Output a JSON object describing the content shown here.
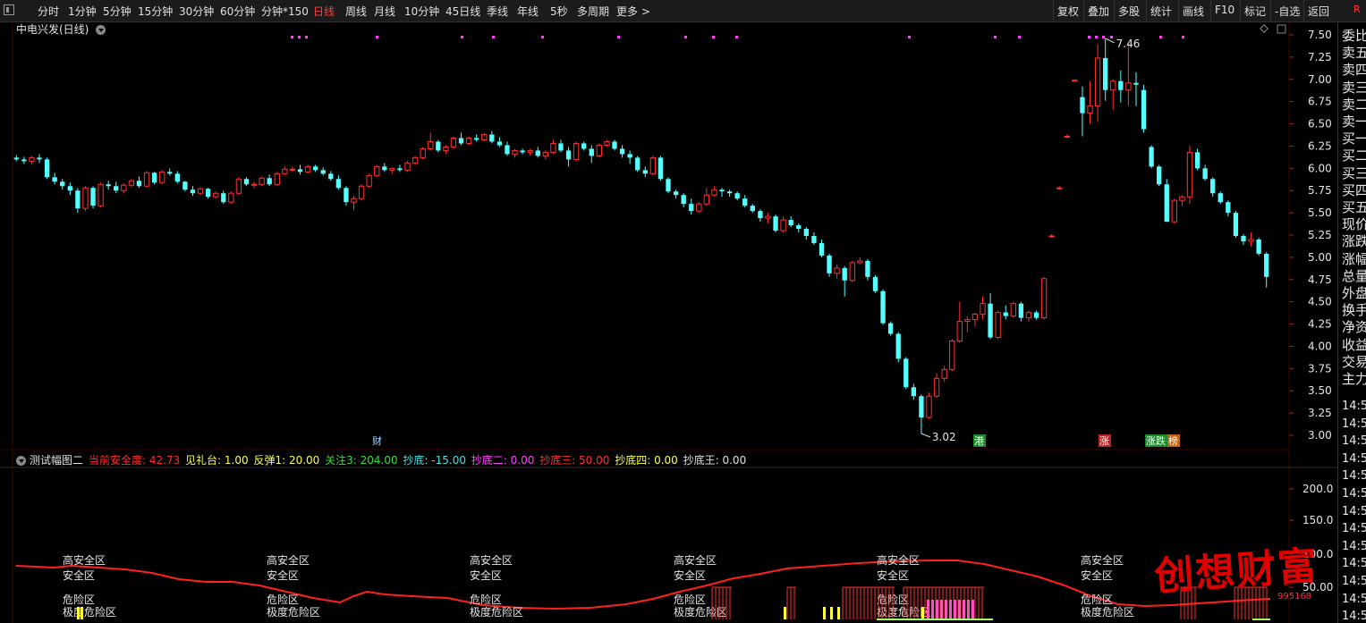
{
  "toolbar": {
    "items": [
      "分时",
      "1分钟",
      "5分钟",
      "15分钟",
      "30分钟",
      "60分钟",
      "分钟*150",
      "日线",
      "周线",
      "月线",
      "10分钟",
      "45日线",
      "季线",
      "年线",
      "5秒",
      "多周期",
      "更多 >"
    ],
    "active_index": 7,
    "right_items": [
      "复权",
      "叠加",
      "多股",
      "统计",
      "画线",
      "F10",
      "标记",
      "-自选",
      "返回"
    ],
    "corner": "R"
  },
  "title": {
    "stock_name": "中电兴发(日线)"
  },
  "right_panel": {
    "labels": [
      "委比",
      "卖五",
      "卖四",
      "卖三",
      "卖二",
      "卖一",
      "买一",
      "买二",
      "买三",
      "买四",
      "买五",
      "现价",
      "涨跌",
      "涨幅",
      "总量",
      "外盘",
      "换手",
      "净资",
      "收益",
      "交易",
      "主力"
    ],
    "times": [
      "14:5",
      "14:5",
      "14:5",
      "14:5",
      "14:5",
      "14:5",
      "14:5",
      "14:5",
      "14:5",
      "14:5",
      "14:5",
      "14:5",
      "14:5"
    ]
  },
  "indicator": {
    "name": "测试幅图二",
    "items": [
      {
        "label": "当前安全度:",
        "value": "42.73",
        "color": "#ff2a2a"
      },
      {
        "label": "见礼台:",
        "value": "1.00",
        "color": "#ffff50"
      },
      {
        "label": "反弹1:",
        "value": "20.00",
        "color": "#ffff50"
      },
      {
        "label": "关注3:",
        "value": "204.00",
        "color": "#30e030"
      },
      {
        "label": "抄底:",
        "value": "-15.00",
        "color": "#40e0e0"
      },
      {
        "label": "抄底二:",
        "value": "0.00",
        "color": "#ff40ff"
      },
      {
        "label": "抄底三:",
        "value": "50.00",
        "color": "#ff3030"
      },
      {
        "label": "抄底四:",
        "value": "0.00",
        "color": "#ffff50"
      },
      {
        "label": "抄底王:",
        "value": "0.00",
        "color": "#e0e0e0"
      }
    ],
    "zones": [
      "高安全区",
      "安全区",
      "危险区",
      "极度危险区"
    ],
    "y_ticks": [
      "200.0",
      "150.0",
      "100.0",
      "50.00"
    ]
  },
  "logo": {
    "text": "创想财富",
    "sub": "995168"
  },
  "chart_data": {
    "type": "candlestick",
    "ylim": [
      2.85,
      7.6
    ],
    "y_ticks": [
      "7.50",
      "7.25",
      "7.00",
      "6.75",
      "6.50",
      "6.25",
      "6.00",
      "5.75",
      "5.50",
      "5.25",
      "5.00",
      "4.75",
      "4.50",
      "4.25",
      "4.00",
      "3.75",
      "3.50",
      "3.25",
      "3.00"
    ],
    "high_label": "7.46",
    "low_label": "3.02",
    "markers": [
      "财",
      "港",
      "涨",
      "涨跌",
      "榜"
    ],
    "colors": {
      "up": "#ff3030",
      "down": "#54ffff",
      "signal_dot": "#ff40ff",
      "safety_line": "#ff2020"
    },
    "ohlc": [
      [
        6.12,
        6.15,
        6.08,
        6.1
      ],
      [
        6.1,
        6.13,
        6.05,
        6.08
      ],
      [
        6.08,
        6.14,
        6.04,
        6.12
      ],
      [
        6.12,
        6.16,
        6.06,
        6.1
      ],
      [
        6.1,
        6.12,
        5.88,
        5.9
      ],
      [
        5.9,
        5.95,
        5.82,
        5.85
      ],
      [
        5.85,
        5.88,
        5.76,
        5.8
      ],
      [
        5.8,
        5.84,
        5.7,
        5.75
      ],
      [
        5.75,
        5.78,
        5.5,
        5.55
      ],
      [
        5.55,
        5.8,
        5.52,
        5.78
      ],
      [
        5.78,
        5.8,
        5.55,
        5.58
      ],
      [
        5.58,
        5.84,
        5.56,
        5.82
      ],
      [
        5.82,
        5.86,
        5.76,
        5.8
      ],
      [
        5.8,
        5.85,
        5.72,
        5.75
      ],
      [
        5.75,
        5.83,
        5.72,
        5.81
      ],
      [
        5.81,
        5.88,
        5.79,
        5.86
      ],
      [
        5.86,
        5.91,
        5.78,
        5.8
      ],
      [
        5.8,
        5.97,
        5.79,
        5.95
      ],
      [
        5.95,
        5.96,
        5.82,
        5.84
      ],
      [
        5.84,
        5.98,
        5.82,
        5.96
      ],
      [
        5.96,
        6.0,
        5.92,
        5.94
      ],
      [
        5.94,
        5.97,
        5.83,
        5.85
      ],
      [
        5.85,
        5.86,
        5.74,
        5.76
      ],
      [
        5.76,
        5.8,
        5.69,
        5.72
      ],
      [
        5.72,
        5.79,
        5.7,
        5.77
      ],
      [
        5.77,
        5.78,
        5.66,
        5.68
      ],
      [
        5.68,
        5.74,
        5.66,
        5.72
      ],
      [
        5.72,
        5.75,
        5.6,
        5.62
      ],
      [
        5.62,
        5.74,
        5.6,
        5.72
      ],
      [
        5.72,
        5.9,
        5.7,
        5.88
      ],
      [
        5.88,
        5.9,
        5.8,
        5.82
      ],
      [
        5.82,
        5.85,
        5.78,
        5.82
      ],
      [
        5.82,
        5.91,
        5.8,
        5.89
      ],
      [
        5.89,
        5.93,
        5.8,
        5.82
      ],
      [
        5.82,
        5.96,
        5.8,
        5.94
      ],
      [
        5.94,
        6.02,
        5.92,
        5.99
      ],
      [
        5.99,
        6.02,
        5.96,
        5.99
      ],
      [
        5.99,
        6.04,
        5.93,
        5.96
      ],
      [
        5.96,
        6.04,
        5.94,
        6.02
      ],
      [
        6.02,
        6.04,
        5.96,
        5.98
      ],
      [
        5.98,
        6.01,
        5.92,
        5.94
      ],
      [
        5.94,
        5.97,
        5.86,
        5.88
      ],
      [
        5.88,
        5.92,
        5.76,
        5.78
      ],
      [
        5.78,
        5.8,
        5.58,
        5.62
      ],
      [
        5.62,
        5.69,
        5.53,
        5.66
      ],
      [
        5.66,
        5.82,
        5.64,
        5.8
      ],
      [
        5.8,
        5.94,
        5.78,
        5.92
      ],
      [
        5.92,
        6.04,
        5.9,
        6.02
      ],
      [
        6.02,
        6.06,
        5.96,
        5.98
      ],
      [
        5.98,
        6.01,
        5.94,
        6.0
      ],
      [
        6.0,
        6.04,
        5.96,
        5.98
      ],
      [
        5.98,
        6.08,
        5.96,
        6.06
      ],
      [
        6.06,
        6.14,
        6.04,
        6.12
      ],
      [
        6.12,
        6.24,
        6.1,
        6.22
      ],
      [
        6.22,
        6.4,
        6.2,
        6.3
      ],
      [
        6.3,
        6.32,
        6.18,
        6.2
      ],
      [
        6.2,
        6.26,
        6.16,
        6.24
      ],
      [
        6.24,
        6.36,
        6.22,
        6.34
      ],
      [
        6.34,
        6.4,
        6.26,
        6.28
      ],
      [
        6.28,
        6.36,
        6.26,
        6.34
      ],
      [
        6.34,
        6.38,
        6.3,
        6.32
      ],
      [
        6.32,
        6.4,
        6.3,
        6.38
      ],
      [
        6.38,
        6.42,
        6.28,
        6.3
      ],
      [
        6.3,
        6.35,
        6.24,
        6.26
      ],
      [
        6.26,
        6.3,
        6.14,
        6.16
      ],
      [
        6.16,
        6.22,
        6.12,
        6.2
      ],
      [
        6.2,
        6.22,
        6.16,
        6.18
      ],
      [
        6.18,
        6.22,
        6.14,
        6.2
      ],
      [
        6.2,
        6.24,
        6.12,
        6.14
      ],
      [
        6.14,
        6.2,
        6.1,
        6.18
      ],
      [
        6.18,
        6.32,
        6.16,
        6.28
      ],
      [
        6.28,
        6.32,
        6.18,
        6.2
      ],
      [
        6.2,
        6.24,
        6.02,
        6.1
      ],
      [
        6.1,
        6.3,
        6.08,
        6.28
      ],
      [
        6.28,
        6.3,
        6.2,
        6.22
      ],
      [
        6.22,
        6.26,
        6.06,
        6.14
      ],
      [
        6.14,
        6.28,
        6.12,
        6.26
      ],
      [
        6.26,
        6.32,
        6.24,
        6.3
      ],
      [
        6.3,
        6.32,
        6.2,
        6.22
      ],
      [
        6.22,
        6.26,
        6.12,
        6.16
      ],
      [
        6.16,
        6.2,
        6.05,
        6.12
      ],
      [
        6.12,
        6.14,
        5.96,
        5.98
      ],
      [
        5.98,
        6.02,
        5.9,
        5.94
      ],
      [
        5.94,
        6.14,
        5.92,
        6.12
      ],
      [
        6.12,
        6.14,
        5.86,
        5.88
      ],
      [
        5.88,
        5.9,
        5.72,
        5.74
      ],
      [
        5.74,
        5.76,
        5.66,
        5.7
      ],
      [
        5.7,
        5.72,
        5.56,
        5.6
      ],
      [
        5.6,
        5.66,
        5.48,
        5.52
      ],
      [
        5.52,
        5.62,
        5.5,
        5.6
      ],
      [
        5.6,
        5.78,
        5.58,
        5.7
      ],
      [
        5.7,
        5.8,
        5.68,
        5.76
      ],
      [
        5.76,
        5.78,
        5.68,
        5.74
      ],
      [
        5.74,
        5.76,
        5.68,
        5.72
      ],
      [
        5.72,
        5.74,
        5.64,
        5.66
      ],
      [
        5.66,
        5.7,
        5.56,
        5.58
      ],
      [
        5.58,
        5.6,
        5.5,
        5.52
      ],
      [
        5.52,
        5.54,
        5.4,
        5.44
      ],
      [
        5.44,
        5.5,
        5.38,
        5.46
      ],
      [
        5.46,
        5.48,
        5.28,
        5.3
      ],
      [
        5.3,
        5.46,
        5.28,
        5.42
      ],
      [
        5.42,
        5.46,
        5.34,
        5.36
      ],
      [
        5.36,
        5.38,
        5.28,
        5.32
      ],
      [
        5.32,
        5.34,
        5.2,
        5.24
      ],
      [
        5.24,
        5.28,
        5.14,
        5.16
      ],
      [
        5.16,
        5.2,
        5.0,
        5.02
      ],
      [
        5.02,
        5.04,
        4.78,
        4.82
      ],
      [
        4.82,
        4.92,
        4.76,
        4.88
      ],
      [
        4.88,
        4.9,
        4.56,
        4.74
      ],
      [
        4.74,
        4.96,
        4.72,
        4.94
      ],
      [
        4.94,
        5.0,
        4.92,
        4.96
      ],
      [
        4.96,
        4.98,
        4.74,
        4.78
      ],
      [
        4.78,
        4.8,
        4.6,
        4.62
      ],
      [
        4.62,
        4.64,
        4.24,
        4.26
      ],
      [
        4.26,
        4.28,
        4.12,
        4.14
      ],
      [
        4.14,
        4.16,
        3.82,
        3.86
      ],
      [
        3.86,
        3.88,
        3.52,
        3.54
      ],
      [
        3.54,
        3.58,
        3.4,
        3.44
      ],
      [
        3.44,
        3.46,
        3.02,
        3.2
      ],
      [
        3.2,
        3.48,
        3.18,
        3.44
      ],
      [
        3.44,
        3.7,
        3.42,
        3.64
      ],
      [
        3.64,
        3.78,
        3.6,
        3.74
      ],
      [
        3.74,
        4.08,
        3.72,
        4.06
      ],
      [
        4.06,
        4.5,
        4.04,
        4.28
      ],
      [
        4.28,
        4.34,
        4.16,
        4.3
      ],
      [
        4.3,
        4.38,
        4.22,
        4.36
      ],
      [
        4.36,
        4.56,
        4.3,
        4.48
      ],
      [
        4.48,
        4.6,
        4.08,
        4.1
      ],
      [
        4.1,
        4.4,
        4.08,
        4.38
      ],
      [
        4.38,
        4.46,
        4.3,
        4.34
      ],
      [
        4.34,
        4.5,
        4.32,
        4.48
      ],
      [
        4.48,
        4.5,
        4.28,
        4.32
      ],
      [
        4.32,
        4.4,
        4.28,
        4.38
      ],
      [
        4.38,
        4.4,
        4.3,
        4.32
      ],
      [
        4.32,
        4.78,
        4.3,
        4.76
      ],
      [
        5.24,
        5.26,
        5.22,
        5.24
      ],
      [
        5.78,
        5.8,
        5.76,
        5.78
      ],
      [
        6.36,
        6.38,
        6.34,
        6.36
      ],
      [
        6.99,
        7.0,
        6.98,
        6.99
      ],
      [
        6.8,
        6.92,
        6.36,
        6.62
      ],
      [
        6.62,
        6.98,
        6.5,
        6.7
      ],
      [
        6.7,
        7.4,
        6.52,
        7.24
      ],
      [
        7.24,
        7.46,
        6.76,
        6.88
      ],
      [
        6.88,
        7.0,
        6.66,
        6.98
      ],
      [
        6.98,
        7.1,
        6.74,
        6.88
      ],
      [
        6.88,
        7.42,
        6.7,
        6.96
      ],
      [
        6.96,
        7.08,
        6.7,
        6.94
      ],
      [
        6.88,
        6.94,
        6.4,
        6.44
      ],
      [
        6.24,
        6.26,
        6.0,
        6.02
      ],
      [
        6.02,
        6.04,
        5.8,
        5.82
      ],
      [
        5.82,
        5.88,
        5.4,
        5.4
      ],
      [
        5.4,
        5.66,
        5.38,
        5.64
      ],
      [
        5.64,
        5.7,
        5.58,
        5.68
      ],
      [
        5.68,
        6.26,
        5.6,
        6.18
      ],
      [
        6.18,
        6.22,
        5.98,
        6.0
      ],
      [
        6.0,
        6.04,
        5.86,
        5.88
      ],
      [
        5.88,
        5.9,
        5.68,
        5.72
      ],
      [
        5.72,
        5.74,
        5.6,
        5.62
      ],
      [
        5.62,
        5.64,
        5.46,
        5.5
      ],
      [
        5.5,
        5.52,
        5.22,
        5.24
      ],
      [
        5.24,
        5.26,
        5.14,
        5.18
      ],
      [
        5.18,
        5.28,
        5.12,
        5.2
      ],
      [
        5.2,
        5.22,
        5.02,
        5.04
      ],
      [
        5.04,
        5.06,
        4.66,
        4.78
      ]
    ]
  }
}
